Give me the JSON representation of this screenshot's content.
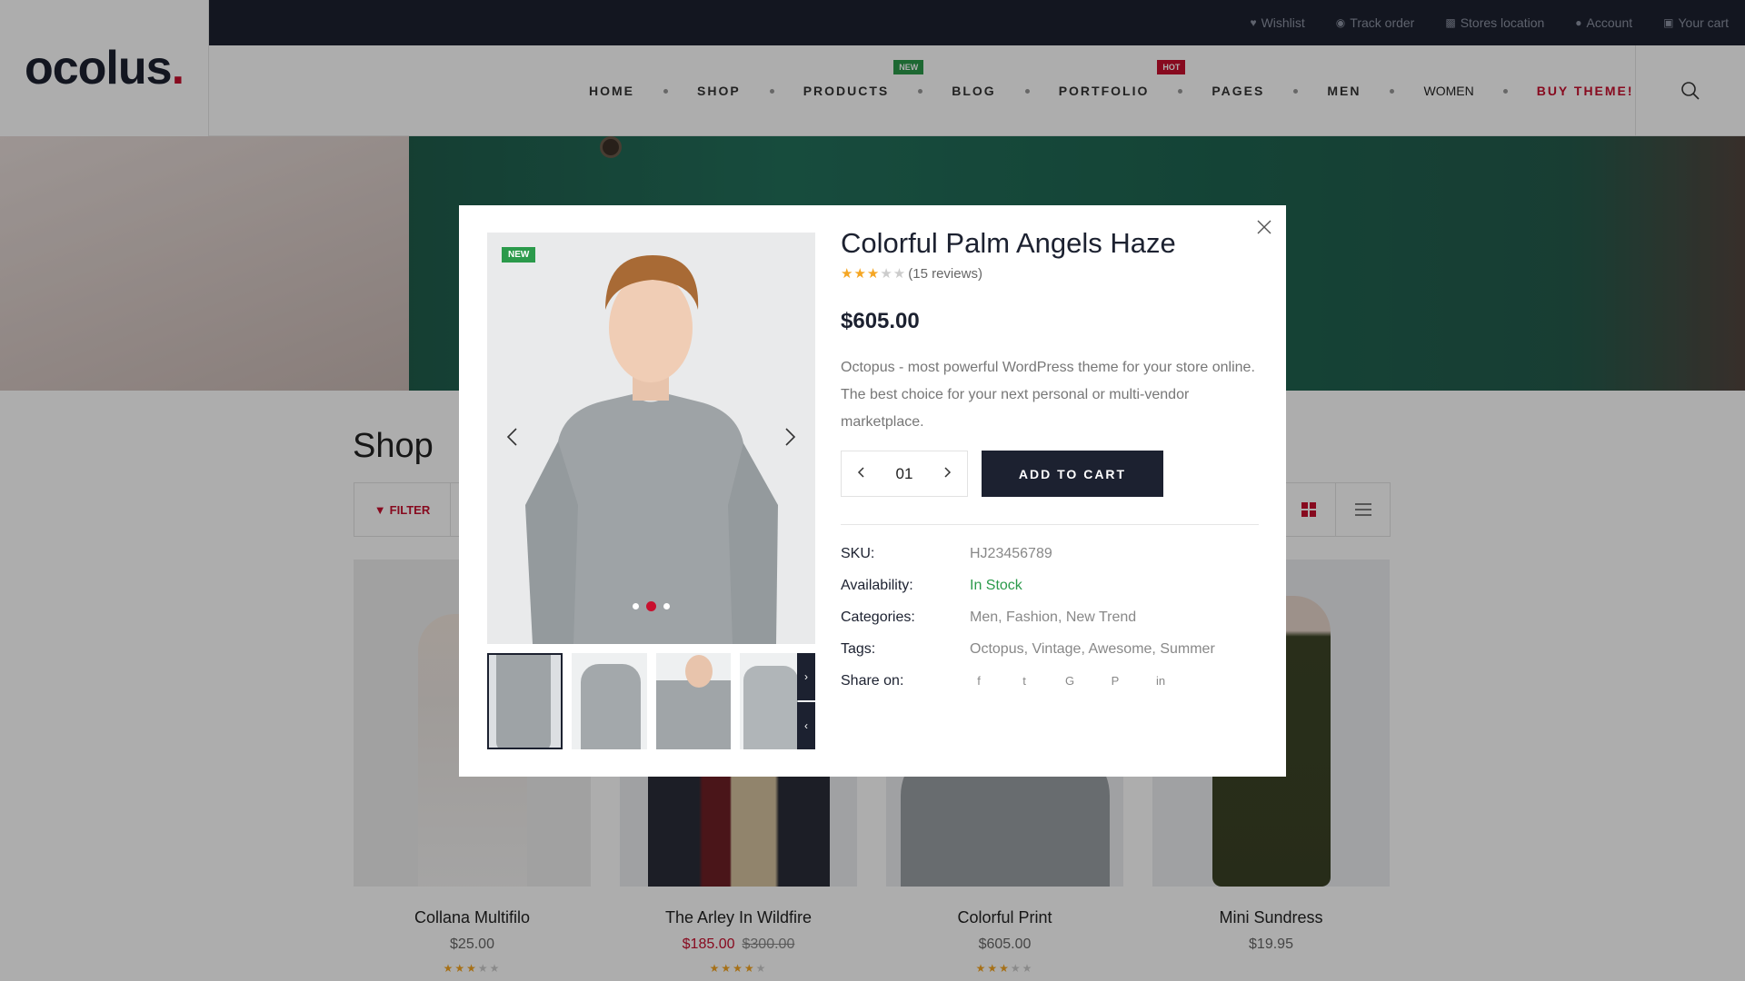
{
  "topbar": {
    "links": [
      {
        "icon": "heart-icon",
        "label": "Wishlist"
      },
      {
        "icon": "map-pin-icon",
        "label": "Track order"
      },
      {
        "icon": "map-icon",
        "label": "Stores location"
      },
      {
        "icon": "user-icon",
        "label": "Account"
      },
      {
        "icon": "cart-icon",
        "label": "Your cart"
      }
    ]
  },
  "logo": {
    "text": "ocolus",
    "dot": "."
  },
  "nav": {
    "items": [
      {
        "label": "HOME"
      },
      {
        "label": "SHOP"
      },
      {
        "label": "PRODUCTS",
        "badge": "NEW"
      },
      {
        "label": "BLOG"
      },
      {
        "label": "PORTFOLIO",
        "badge": "HOT"
      },
      {
        "label": "PAGES"
      },
      {
        "label": "MEN"
      },
      {
        "label": "WOMEN"
      },
      {
        "label": "BUY THEME!"
      }
    ]
  },
  "shop": {
    "title": "Shop",
    "filter_label": "FILTER",
    "products": [
      {
        "name": "Collana Multifilo",
        "price": "$25.00",
        "rating": 3
      },
      {
        "name": "The Arley In Wildfire",
        "sale_price": "$185.00",
        "old_price": "$300.00",
        "rating": 4
      },
      {
        "name": "Colorful Print",
        "price": "$605.00",
        "rating": 3
      },
      {
        "name": "Mini Sundress",
        "price": "$19.95",
        "rating": 0
      }
    ]
  },
  "modal": {
    "badge": "NEW",
    "title": "Colorful Palm Angels Haze",
    "rating": 3,
    "reviews": "(15 reviews)",
    "price": "$605.00",
    "description": "Octopus - most powerful WordPress theme for your store online. The best choice for your next personal or multi-vendor marketplace.",
    "quantity": "01",
    "add_to_cart": "ADD TO CART",
    "meta": {
      "sku_label": "SKU:",
      "sku": "HJ23456789",
      "availability_label": "Availability:",
      "availability": "In Stock",
      "categories_label": "Categories:",
      "categories": "Men, Fashion, New Trend",
      "tags_label": "Tags:",
      "tags": "Octopus, Vintage, Awesome, Summer",
      "share_label": "Share on:"
    },
    "share_icons": [
      "f",
      "t",
      "G",
      "P",
      "in"
    ]
  },
  "colors": {
    "accent": "#c8102e",
    "dark": "#1c2130",
    "green": "#2b9a4b",
    "star": "#f5a623"
  }
}
